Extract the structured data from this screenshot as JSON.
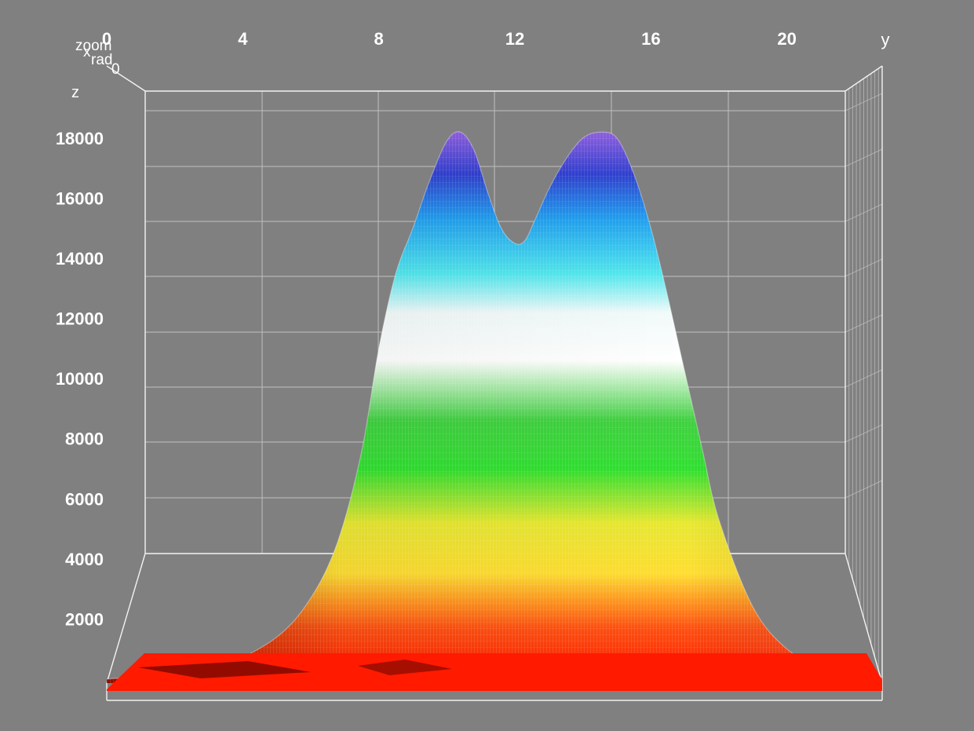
{
  "colors": {
    "background": "#808080",
    "grid": "#bfbfbf",
    "frame": "#f2f2f2",
    "text": "#ffffff"
  },
  "chart_data": {
    "type": "surface-3d",
    "view": "front",
    "y_axis": {
      "label": "y",
      "range": [
        0,
        22.8
      ],
      "ticks": [
        0,
        4,
        8,
        12,
        16,
        20
      ]
    },
    "z_axis": {
      "label": "z",
      "range": [
        0,
        19800
      ],
      "ticks": [
        2000,
        4000,
        6000,
        8000,
        10000,
        12000,
        14000,
        16000,
        18000
      ]
    },
    "x_axis": {
      "label": "x",
      "note": "depth axis; tick labels overlap near the origin corner",
      "corner_labels": [
        "zoom",
        "x",
        "rad",
        "0"
      ]
    },
    "grid": true,
    "profile": {
      "y": [
        0,
        2,
        3.5,
        5,
        6,
        6.8,
        7.5,
        8,
        8.5,
        9,
        9.5,
        10,
        10.4,
        10.8,
        11.2,
        11.6,
        12,
        12.3,
        12.6,
        13,
        13.5,
        14,
        14.5,
        15,
        15.5,
        16,
        16.5,
        17,
        17.5,
        18,
        19,
        20,
        21,
        22,
        22.8
      ],
      "z": [
        0,
        200,
        500,
        1400,
        2700,
        4600,
        7600,
        11000,
        13500,
        15000,
        16600,
        17900,
        18200,
        17600,
        16200,
        15000,
        14500,
        14600,
        15300,
        16300,
        17300,
        18000,
        18200,
        18000,
        16800,
        15000,
        12700,
        10200,
        7700,
        5300,
        2400,
        1000,
        450,
        150,
        60
      ]
    },
    "colormap": [
      {
        "z": 0,
        "color": "#ff1a00"
      },
      {
        "z": 1700,
        "color": "#ff5010"
      },
      {
        "z": 3500,
        "color": "#ffdd30"
      },
      {
        "z": 5200,
        "color": "#e8e830"
      },
      {
        "z": 7000,
        "color": "#30e030"
      },
      {
        "z": 8600,
        "color": "#40d040"
      },
      {
        "z": 10600,
        "color": "#ffffff"
      },
      {
        "z": 12200,
        "color": "#f2fafa"
      },
      {
        "z": 13500,
        "color": "#50e8ee"
      },
      {
        "z": 15300,
        "color": "#20a0f0"
      },
      {
        "z": 16800,
        "color": "#3040d0"
      },
      {
        "z": 18200,
        "color": "#9060e0"
      }
    ]
  }
}
